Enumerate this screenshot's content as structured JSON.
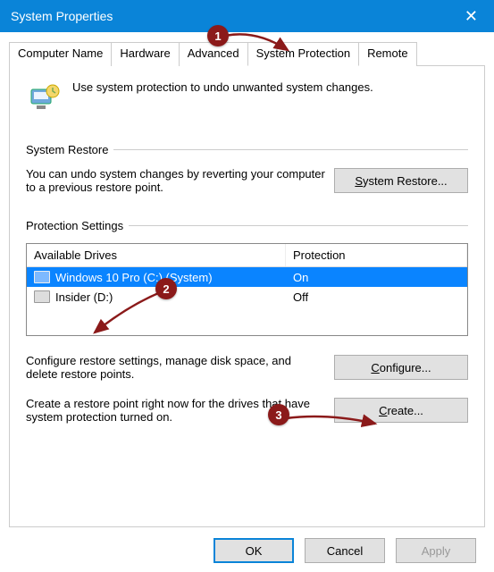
{
  "window": {
    "title": "System Properties"
  },
  "tabs": {
    "computer_name": "Computer Name",
    "hardware": "Hardware",
    "advanced": "Advanced",
    "system_protection": "System Protection",
    "remote": "Remote"
  },
  "intro_text": "Use system protection to undo unwanted system changes.",
  "restore_group": {
    "label": "System Restore",
    "text": "You can undo system changes by reverting your computer to a previous restore point.",
    "button_prefix": "S",
    "button_rest": "ystem Restore..."
  },
  "protection_group": {
    "label": "Protection Settings",
    "headers": {
      "drives": "Available Drives",
      "protection": "Protection"
    },
    "rows": [
      {
        "name": "Windows 10 Pro (C:) (System)",
        "status": "On",
        "selected": true
      },
      {
        "name": "Insider (D:)",
        "status": "Off",
        "selected": false
      }
    ],
    "configure_text": "Configure restore settings, manage disk space, and delete restore points.",
    "configure_button_prefix": "C",
    "configure_button_rest": "onfigure...",
    "create_text": "Create a restore point right now for the drives that have system protection turned on.",
    "create_button_prefix": "C",
    "create_button_rest": "reate..."
  },
  "dialog_buttons": {
    "ok": "OK",
    "cancel": "Cancel",
    "apply": "Apply"
  },
  "annotations": {
    "badge1": "1",
    "badge2": "2",
    "badge3": "3"
  }
}
